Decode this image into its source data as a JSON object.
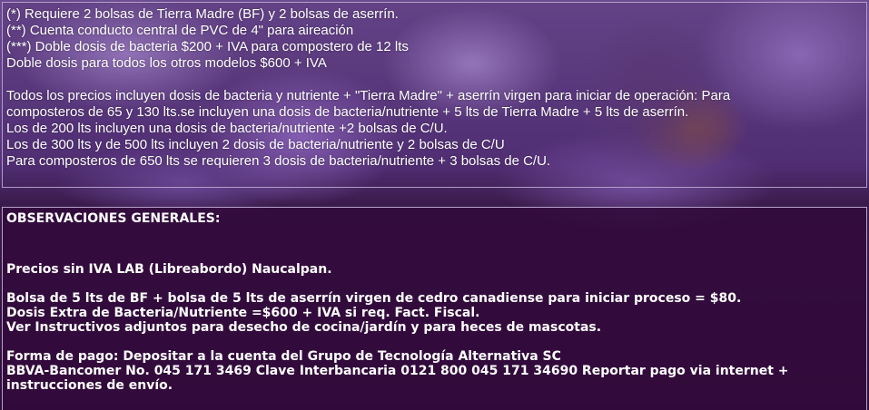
{
  "notes": {
    "lines": [
      "(*) Requiere 2 bolsas de Tierra Madre (BF) y 2 bolsas de aserrín.",
      " (**) Cuenta conducto central de PVC de 4\" para aireación",
      " (***) Doble dosis de bacteria $200 + IVA para compostero de 12 lts",
      " Doble dosis para todos los otros modelos $600 + IVA"
    ],
    "paragraph": [
      " Todos los precios incluyen dosis de bacteria y nutriente + \"Tierra Madre\" + aserrín virgen para iniciar de operación: Para",
      " composteros de 65 y 130 lts.se incluyen una dosis de bacteria/nutriente + 5 lts de Tierra Madre + 5 lts de aserrín.",
      " Los de 200 lts incluyen una dosis de bacteria/nutriente +2 bolsas de C/U.",
      "Los de 300 lts y de 500 lts incluyen 2 dosis de bacteria/nutriente y 2 bolsas de C/U",
      " Para composteros de 650 lts se requieren 3 dosis de bacteria/nutriente + 3 bolsas de C/U."
    ]
  },
  "observaciones": {
    "heading": "OBSERVACIONES GENERALES:",
    "precios": "Precios sin IVA LAB (Libreabordo) Naucalpan.",
    "items": [
      "Bolsa de 5 lts de BF + bolsa de 5 lts de aserrín virgen de cedro canadiense para iniciar proceso = $80.",
      "Dosis Extra de Bacteria/Nutriente =$600 + IVA si req. Fact. Fiscal.",
      "Ver Instructivos adjuntos para desecho de cocina/jardín y para heces de mascotas."
    ],
    "pago_1": "Forma de pago: Depositar a la cuenta del Grupo de Tecnología Alternativa SC",
    "pago_2": "BBVA-Bancomer No. 045 171 3469 Clave Interbancaria 0121 800 045 171 34690 Reportar pago via internet + instrucciones de envío."
  }
}
